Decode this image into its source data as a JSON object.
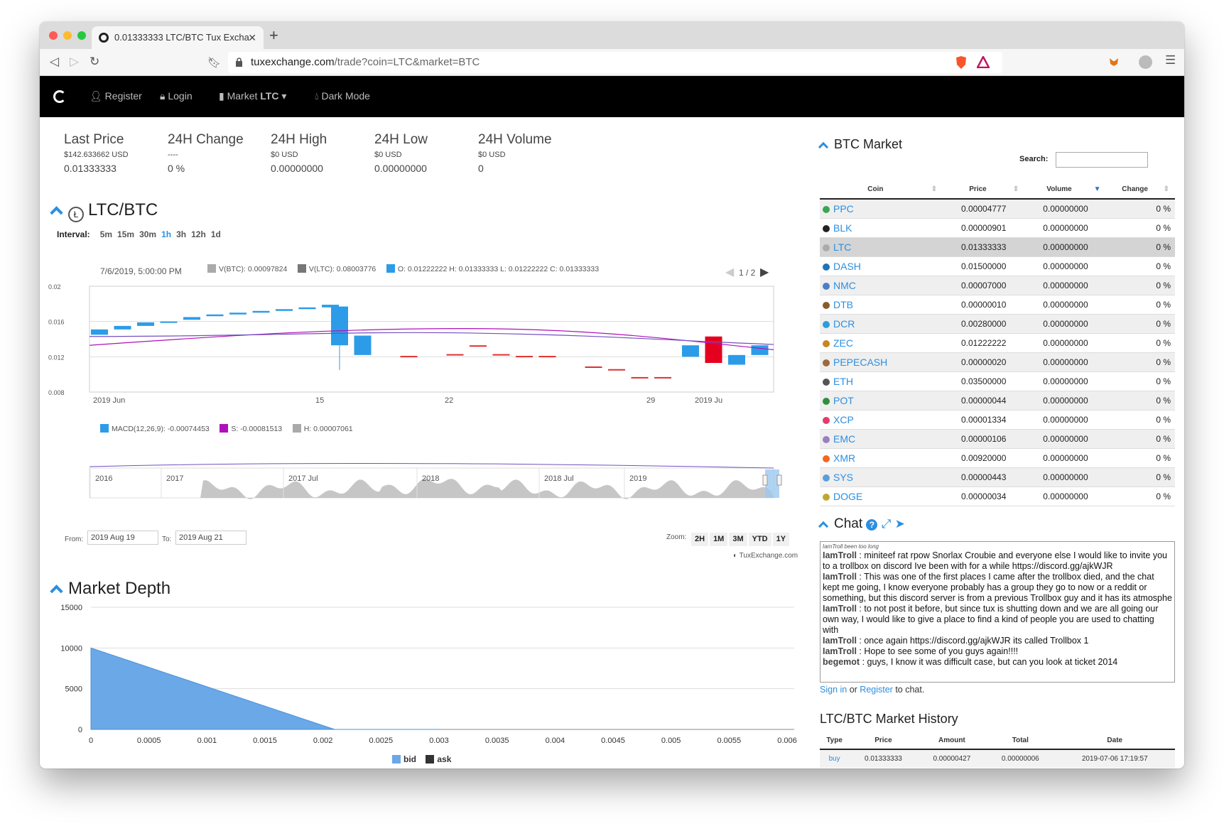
{
  "browser": {
    "tab_title": "0.01333333 LTC/BTC Tux Excha",
    "url_host": "tuxexchange.com",
    "url_path": "/trade?coin=LTC&market=BTC"
  },
  "nav": {
    "register": "Register",
    "login": "Login",
    "market_prefix": "Market",
    "market_coin": "LTC",
    "dark_mode": "Dark Mode"
  },
  "stats": [
    {
      "label": "Last Price",
      "sub": "$142.633662 USD",
      "value": "0.01333333"
    },
    {
      "label": "24H Change",
      "sub": "----",
      "value": "0 %"
    },
    {
      "label": "24H High",
      "sub": "$0 USD",
      "value": "0.00000000"
    },
    {
      "label": "24H Low",
      "sub": "$0 USD",
      "value": "0.00000000"
    },
    {
      "label": "24H Volume",
      "sub": "$0 USD",
      "value": "0"
    }
  ],
  "pair": {
    "title": "LTC/BTC",
    "interval_label": "Interval:",
    "intervals": [
      "5m",
      "15m",
      "30m",
      "1h",
      "3h",
      "12h",
      "1d"
    ],
    "active_interval": "1h"
  },
  "candle_info": {
    "date": "7/6/2019, 5:00:00 PM",
    "vbtc": "V(BTC): 0.00097824",
    "vltc": "V(LTC): 0.08003776",
    "ohlc": "O: 0.01222222 H: 0.01333333 L: 0.01222222 C: 0.01333333",
    "page": "1 / 2"
  },
  "macd_legend": {
    "macd": "MACD(12,26,9): -0.00074453",
    "s": "S: -0.00081513",
    "h": "H: 0.00007061"
  },
  "navigator": {
    "labels": [
      "2016",
      "2017",
      "2017 Jul",
      "2018",
      "2018 Jul",
      "2019"
    ]
  },
  "range": {
    "from_label": "From:",
    "from": "2019 Aug 19",
    "to_label": "To:",
    "to": "2019 Aug 21",
    "zoom_label": "Zoom:",
    "zoom": [
      "2H",
      "1M",
      "3M",
      "YTD",
      "1Y"
    ],
    "credit": "TuxExchange.com"
  },
  "chart_data": [
    {
      "type": "candlestick",
      "ylim": [
        0.008,
        0.02
      ],
      "yticks": [
        "0.02",
        "0.016",
        "0.012",
        "0.008"
      ],
      "xticks": [
        "2019 Jun",
        "15",
        "22",
        "29",
        "2019 Ju"
      ],
      "candles": [
        [
          0,
          0.0145,
          0.0151
        ],
        [
          1,
          0.0151,
          0.0155
        ],
        [
          2,
          0.0155,
          0.0159
        ],
        [
          3,
          0.016,
          0.016
        ],
        [
          4,
          0.0162,
          0.0165
        ],
        [
          5,
          0.0166,
          0.0168
        ],
        [
          6,
          0.0168,
          0.017
        ],
        [
          7,
          0.017,
          0.0172
        ],
        [
          8,
          0.0172,
          0.0174
        ],
        [
          9,
          0.0174,
          0.0176
        ],
        [
          10,
          0.0176,
          0.0179
        ],
        [
          10.4,
          0.0177,
          0.0133
        ],
        [
          11.4,
          0.0144,
          0.0122
        ],
        [
          13.4,
          0.0121,
          0.0121
        ],
        [
          15.4,
          0.0123,
          0.0123
        ],
        [
          16.4,
          0.0133,
          0.0133
        ],
        [
          17.4,
          0.0123,
          0.0123
        ],
        [
          18.4,
          0.0121,
          0.0121
        ],
        [
          19.4,
          0.0121,
          0.0121
        ],
        [
          21.4,
          0.0109,
          0.0109
        ],
        [
          22.4,
          0.0106,
          0.0106
        ],
        [
          23.4,
          0.0097,
          0.0097
        ],
        [
          24.4,
          0.0097,
          0.0097
        ],
        [
          25.6,
          0.0133,
          0.012
        ],
        [
          26.6,
          0.0143,
          0.0113
        ],
        [
          27.6,
          0.0122,
          0.0111
        ],
        [
          28.6,
          0.0133,
          0.0122
        ]
      ]
    },
    {
      "type": "area",
      "title": "Market Depth",
      "ylim": [
        0,
        15000
      ],
      "yticks": [
        "15000",
        "10000",
        "5000",
        "0"
      ],
      "xticks": [
        "0",
        "0.0005",
        "0.001",
        "0.0015",
        "0.002",
        "0.0025",
        "0.003",
        "0.0035",
        "0.004",
        "0.0045",
        "0.005",
        "0.0055",
        "0.006"
      ],
      "series": [
        {
          "name": "bid",
          "color": "#6aa8e8",
          "points": [
            [
              0,
              10000
            ],
            [
              0.0021,
              0
            ],
            [
              0.003,
              0
            ]
          ]
        },
        {
          "name": "ask",
          "color": "#333333",
          "points": []
        }
      ]
    }
  ],
  "depth": {
    "title": "Market Depth",
    "legend_bid": "bid",
    "legend_ask": "ask"
  },
  "market": {
    "title": "BTC Market",
    "search_label": "Search:",
    "headers": [
      "Coin",
      "Price",
      "Volume",
      "Change"
    ],
    "rows": [
      {
        "coin": "PPC",
        "price": "0.00004777",
        "volume": "0.00000000",
        "change": "0 %",
        "color": "#3aa655"
      },
      {
        "coin": "BLK",
        "price": "0.00000901",
        "volume": "0.00000000",
        "change": "0 %",
        "color": "#222222"
      },
      {
        "coin": "LTC",
        "price": "0.01333333",
        "volume": "0.00000000",
        "change": "0 %",
        "color": "#aaaaaa"
      },
      {
        "coin": "DASH",
        "price": "0.01500000",
        "volume": "0.00000000",
        "change": "0 %",
        "color": "#1c75bc"
      },
      {
        "coin": "NMC",
        "price": "0.00007000",
        "volume": "0.00000000",
        "change": "0 %",
        "color": "#4a7ec8"
      },
      {
        "coin": "DTB",
        "price": "0.00000010",
        "volume": "0.00000000",
        "change": "0 %",
        "color": "#8b5a2b"
      },
      {
        "coin": "DCR",
        "price": "0.00280000",
        "volume": "0.00000000",
        "change": "0 %",
        "color": "#2d9cdb"
      },
      {
        "coin": "ZEC",
        "price": "0.01222222",
        "volume": "0.00000000",
        "change": "0 %",
        "color": "#c7861f"
      },
      {
        "coin": "PEPECASH",
        "price": "0.00000020",
        "volume": "0.00000000",
        "change": "0 %",
        "color": "#9b6b3a"
      },
      {
        "coin": "ETH",
        "price": "0.03500000",
        "volume": "0.00000000",
        "change": "0 %",
        "color": "#555555"
      },
      {
        "coin": "POT",
        "price": "0.00000044",
        "volume": "0.00000000",
        "change": "0 %",
        "color": "#2f8f3a"
      },
      {
        "coin": "XCP",
        "price": "0.00001334",
        "volume": "0.00000000",
        "change": "0 %",
        "color": "#e23b6b"
      },
      {
        "coin": "EMC",
        "price": "0.00000106",
        "volume": "0.00000000",
        "change": "0 %",
        "color": "#9b7fc0"
      },
      {
        "coin": "XMR",
        "price": "0.00920000",
        "volume": "0.00000000",
        "change": "0 %",
        "color": "#f26822"
      },
      {
        "coin": "SYS",
        "price": "0.00000443",
        "volume": "0.00000000",
        "change": "0 %",
        "color": "#5aa0d8"
      },
      {
        "coin": "DOGE",
        "price": "0.00000034",
        "volume": "0.00000000",
        "change": "0 %",
        "color": "#c2a633"
      }
    ]
  },
  "chat": {
    "title": "Chat",
    "tiny": "IamTroll been too long",
    "messages": [
      {
        "user": "IamTroll",
        "text": " : miniteef rat rpow Snorlax Croubie and everyone else I would like to invite you to a trollbox on discord Ive been with for a while https://discord.gg/ajkWJR"
      },
      {
        "user": "IamTroll",
        "text": " : This was one of the first places I came after the trollbox died, and the chat kept me going, I know everyone probably has a group they go to now or a reddit or something, but this discord server is from a previous Trollbox guy and it has its atmosphe"
      },
      {
        "user": "IamTroll",
        "text": " : to not post it before, but since tux is shutting down and we are all going our own way, I would like to give a place to find a kind of people you are used to chatting with"
      },
      {
        "user": "IamTroll",
        "text": " : once again https://discord.gg/ajkWJR its called Trollbox 1"
      },
      {
        "user": "IamTroll",
        "text": " : Hope to see some of you guys again!!!!"
      },
      {
        "user": "begemot",
        "text": " : guys, I know it was difficult case, but can you look at ticket 2014"
      }
    ],
    "signin": "Sign in",
    "or": " or ",
    "register": "Register",
    "tail": " to chat."
  },
  "history": {
    "title": "LTC/BTC Market History",
    "headers": [
      "Type",
      "Price",
      "Amount",
      "Total",
      "Date"
    ],
    "rows": [
      {
        "type": "buy",
        "price": "0.01333333",
        "amount": "0.00000427",
        "total": "0.00000006",
        "date": "2019-07-06 17:19:57"
      }
    ]
  }
}
